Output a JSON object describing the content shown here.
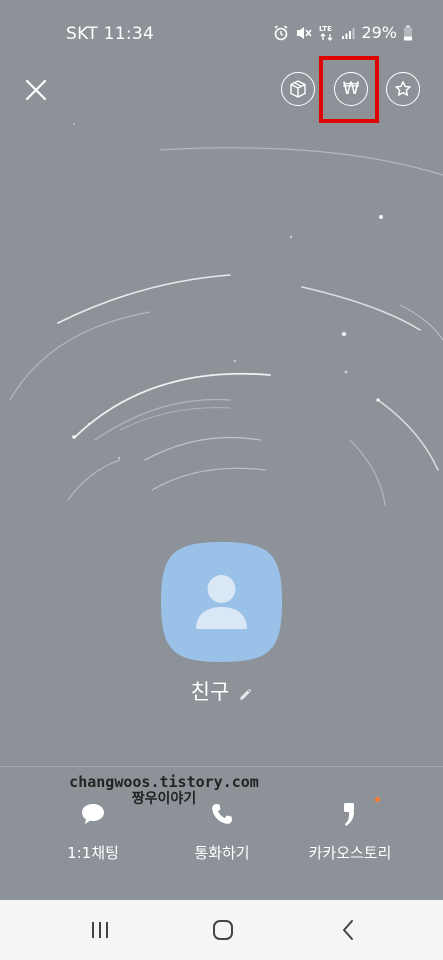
{
  "status_bar": {
    "carrier_time": "SKT 11:34",
    "battery_percent": "29%",
    "icons": [
      "alarm-icon",
      "mute-icon",
      "lte-icon",
      "signal-icon",
      "battery-icon"
    ]
  },
  "top_bar": {
    "close_icon": "close-icon",
    "buttons": [
      "gift-icon",
      "won-pay-icon",
      "star-icon"
    ],
    "won_symbol": "₩"
  },
  "profile": {
    "name": "친구"
  },
  "watermark": {
    "line1": "changwoos.tistory.com",
    "line2": "짱우이야기"
  },
  "actions": [
    {
      "label": "1:1채팅",
      "icon": "chat-bubble-icon"
    },
    {
      "label": "통화하기",
      "icon": "phone-icon"
    },
    {
      "label": "카카오스토리",
      "icon": "kakaostory-icon"
    }
  ],
  "navbar": {
    "icons": [
      "recent-apps-icon",
      "home-icon",
      "back-icon"
    ]
  },
  "colors": {
    "background": "#8d9298",
    "avatar": "#9ac1e8",
    "highlight": "#e10000",
    "story_dot": "#ff7a2e",
    "navbar": "#f5f5f5"
  }
}
